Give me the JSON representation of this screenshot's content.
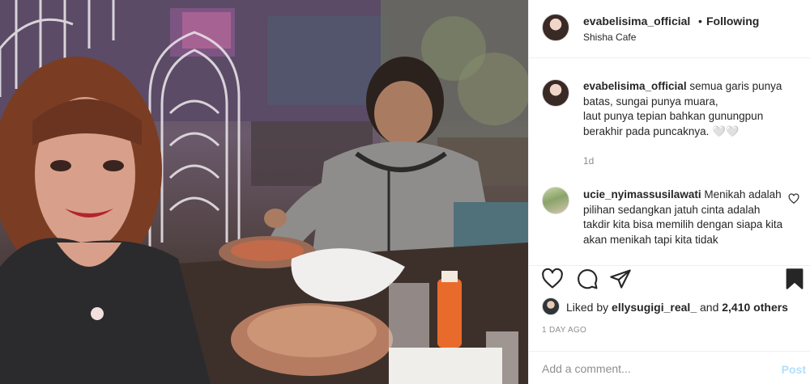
{
  "post": {
    "username": "evabelisima_official",
    "dot": "•",
    "follow_status": "Following",
    "location": "Shisha Cafe"
  },
  "caption": {
    "username": "evabelisima_official",
    "text": "semua garis punya batas, sungai punya muara,\nlaut punya tepian bahkan gunungpun berakhir pada puncaknya. 🤍🤍",
    "age": "1d"
  },
  "comments": [
    {
      "username": "ucie_nyimassusilawati",
      "text": "Menikah adalah pilihan sedangkan jatuh cinta adalah takdir kita bisa memilih dengan siapa kita akan menikah tapi kita tidak"
    }
  ],
  "likes": {
    "prefix": "Liked by",
    "user": "ellysugigi_real_",
    "conj": "and",
    "count": "2,410 others"
  },
  "time_ago": "1 DAY AGO",
  "add_comment": {
    "placeholder": "Add a comment...",
    "post_label": "Post"
  },
  "colors": {
    "text": "#262626",
    "muted": "#8e8e8e",
    "post_disabled": "#b2dffc"
  },
  "icons": {
    "like": "heart-icon",
    "comment": "comment-icon",
    "share": "share-icon",
    "save": "bookmark-icon",
    "comment_like": "heart-icon"
  }
}
